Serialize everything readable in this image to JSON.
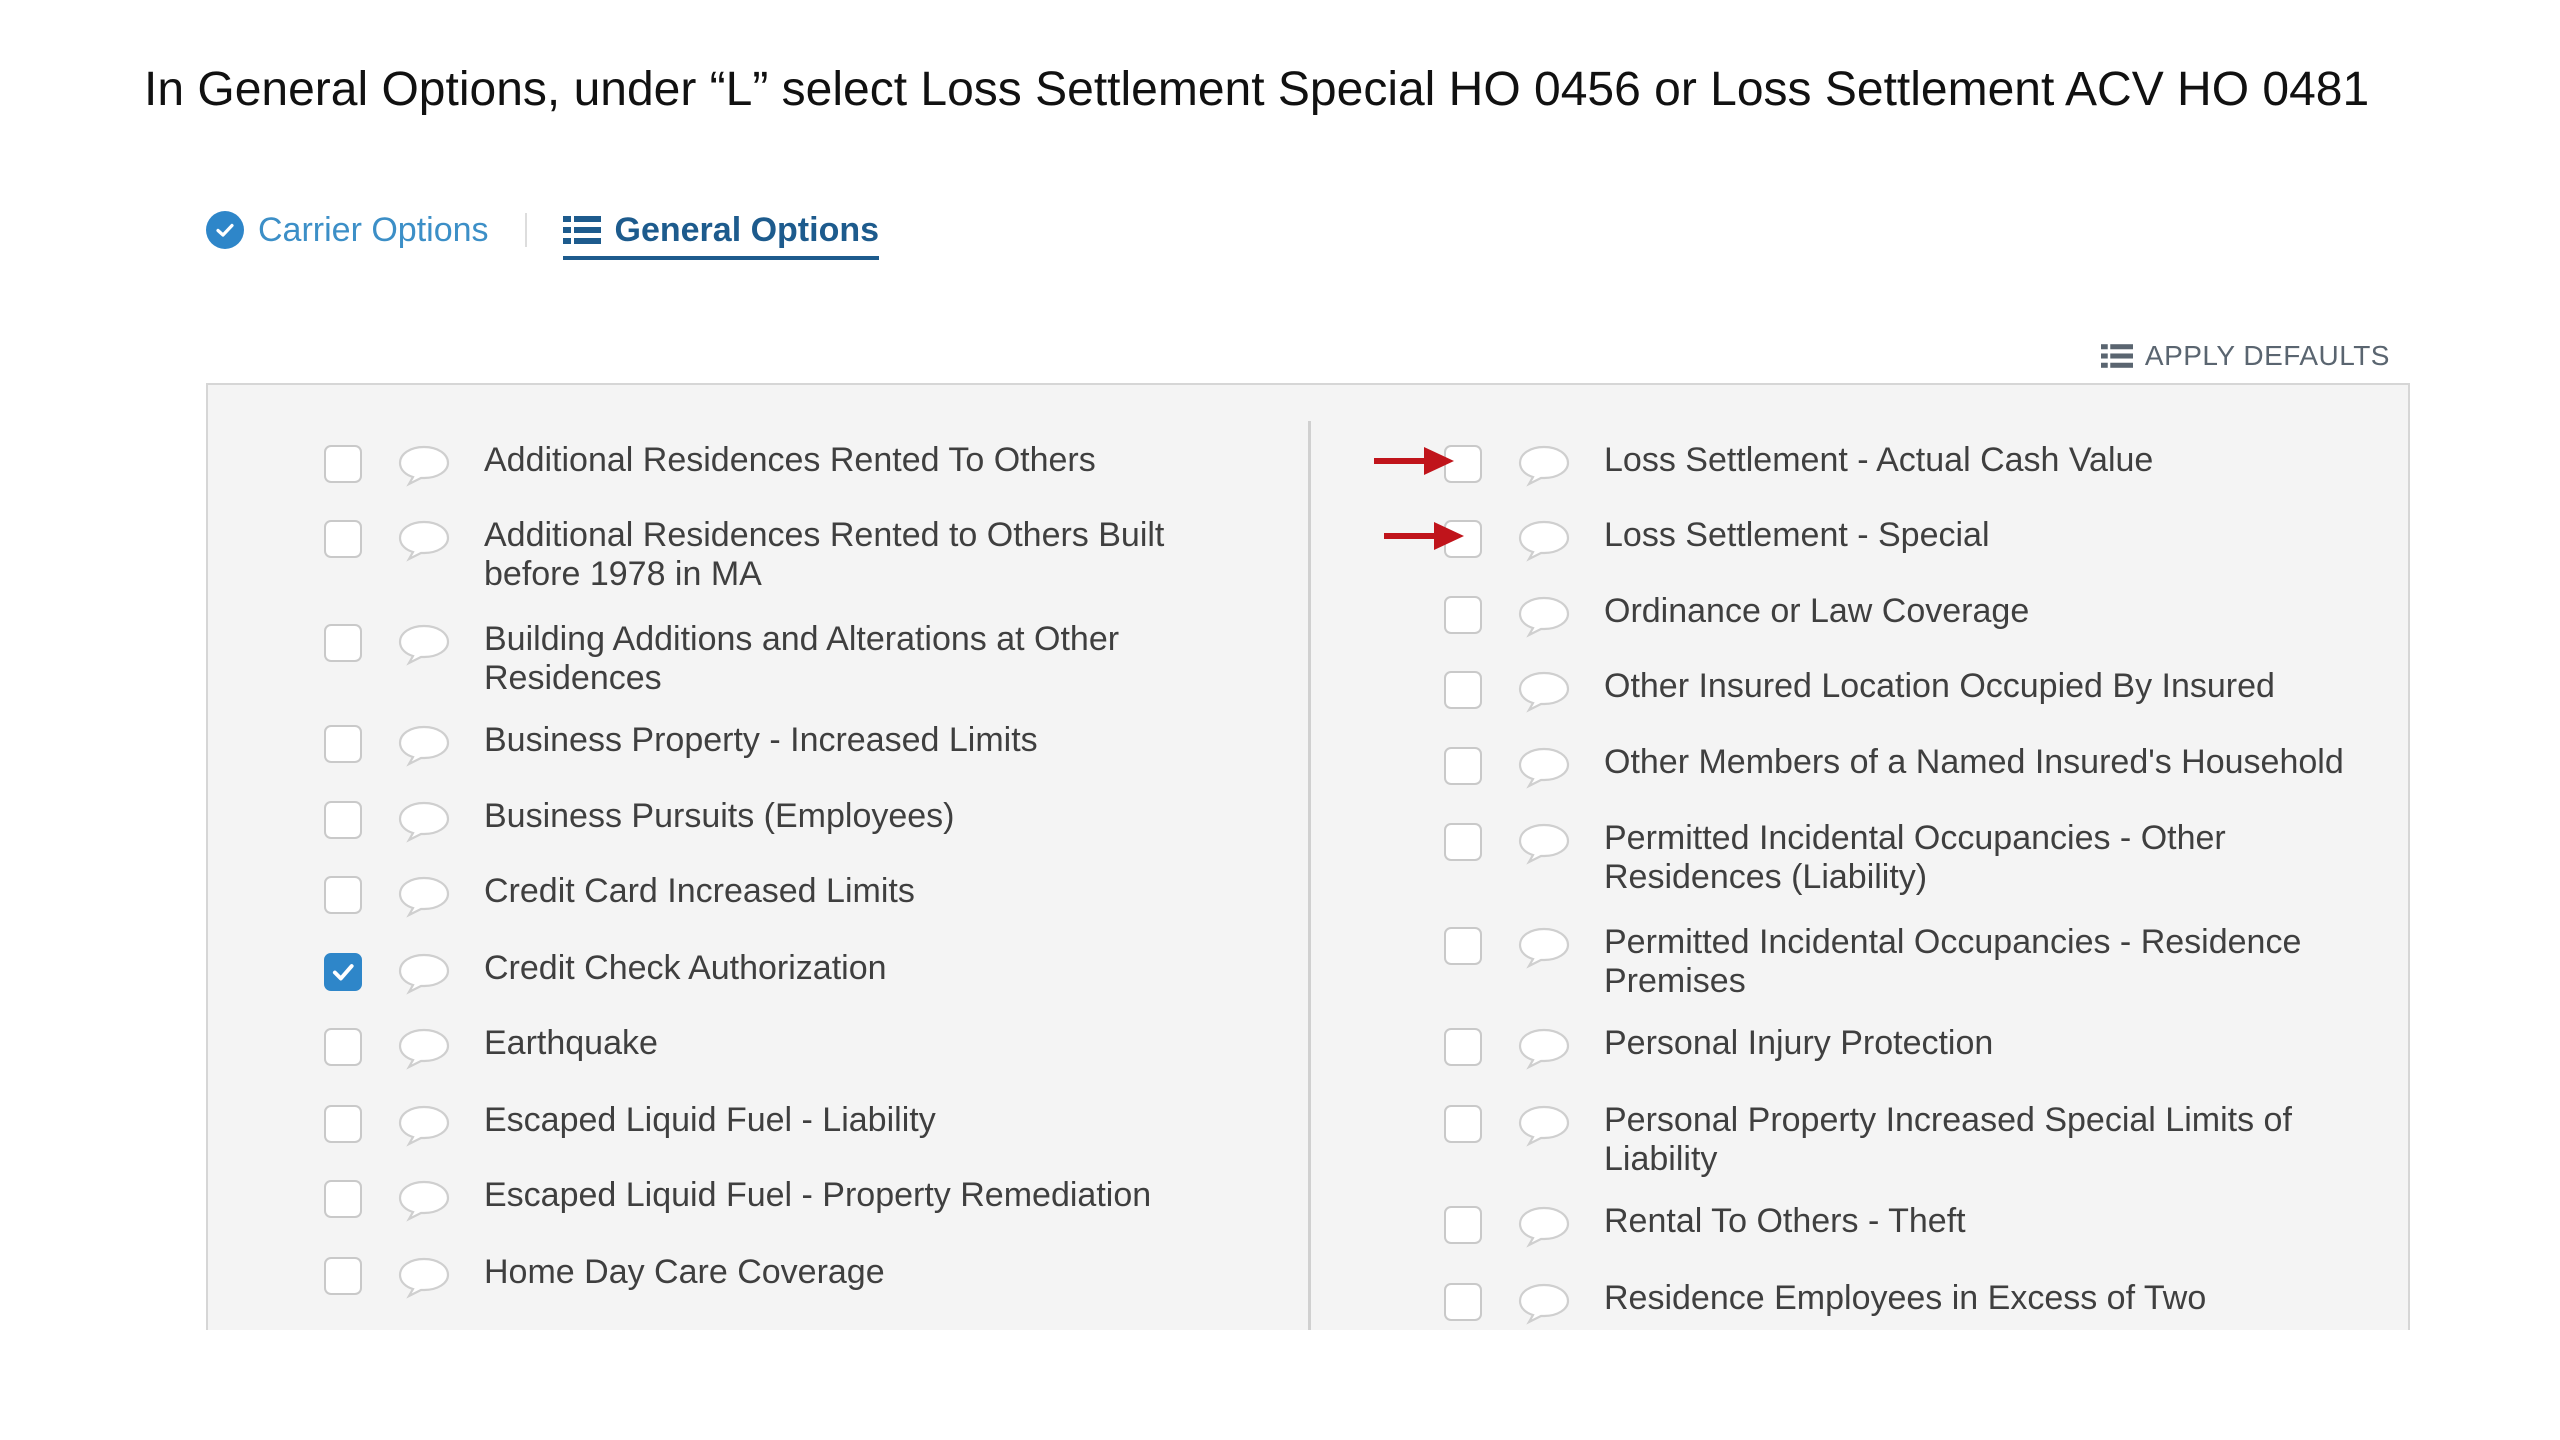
{
  "instruction": "In General Options, under “L” select Loss Settlement Special HO 0456 or Loss Settlement ACV HO 0481",
  "tabs": {
    "carrier": {
      "label": "Carrier Options",
      "icon": "check-circle-icon"
    },
    "general": {
      "label": "General Options",
      "icon": "list-icon",
      "active": true
    }
  },
  "apply_defaults": {
    "label": "APPLY DEFAULTS",
    "icon": "list-icon"
  },
  "colors": {
    "accent": "#2e86c9",
    "active_tab": "#1d5b8d",
    "panel_bg": "#f4f4f4",
    "arrow": "#c0141b"
  },
  "left_options": [
    {
      "label": "Additional Residences Rented To Others",
      "checked": false
    },
    {
      "label": "Additional Residences Rented to Others Built before 1978 in MA",
      "checked": false
    },
    {
      "label": "Building Additions and Alterations at Other Residences",
      "checked": false
    },
    {
      "label": "Business Property - Increased Limits",
      "checked": false
    },
    {
      "label": "Business Pursuits (Employees)",
      "checked": false
    },
    {
      "label": "Credit Card Increased Limits",
      "checked": false
    },
    {
      "label": "Credit Check Authorization",
      "checked": true
    },
    {
      "label": "Earthquake",
      "checked": false
    },
    {
      "label": "Escaped Liquid Fuel - Liability",
      "checked": false
    },
    {
      "label": "Escaped Liquid Fuel - Property Remediation",
      "checked": false
    },
    {
      "label": "Home Day Care Coverage",
      "checked": false
    }
  ],
  "right_options": [
    {
      "label": "Loss Settlement - Actual Cash Value",
      "checked": false,
      "arrow": true
    },
    {
      "label": "Loss Settlement - Special",
      "checked": false,
      "arrow": true
    },
    {
      "label": "Ordinance or Law Coverage",
      "checked": false
    },
    {
      "label": "Other Insured Location Occupied By Insured",
      "checked": false
    },
    {
      "label": "Other Members of a Named Insured's Household",
      "checked": false
    },
    {
      "label": "Permitted Incidental Occupancies - Other Residences (Liability)",
      "checked": false
    },
    {
      "label": "Permitted Incidental Occupancies - Residence Premises",
      "checked": false
    },
    {
      "label": "Personal Injury Protection",
      "checked": false
    },
    {
      "label": "Personal Property Increased Special Limits of Liability",
      "checked": false
    },
    {
      "label": "Rental To Others - Theft",
      "checked": false
    },
    {
      "label": "Residence Employees in Excess of Two",
      "checked": false
    }
  ]
}
